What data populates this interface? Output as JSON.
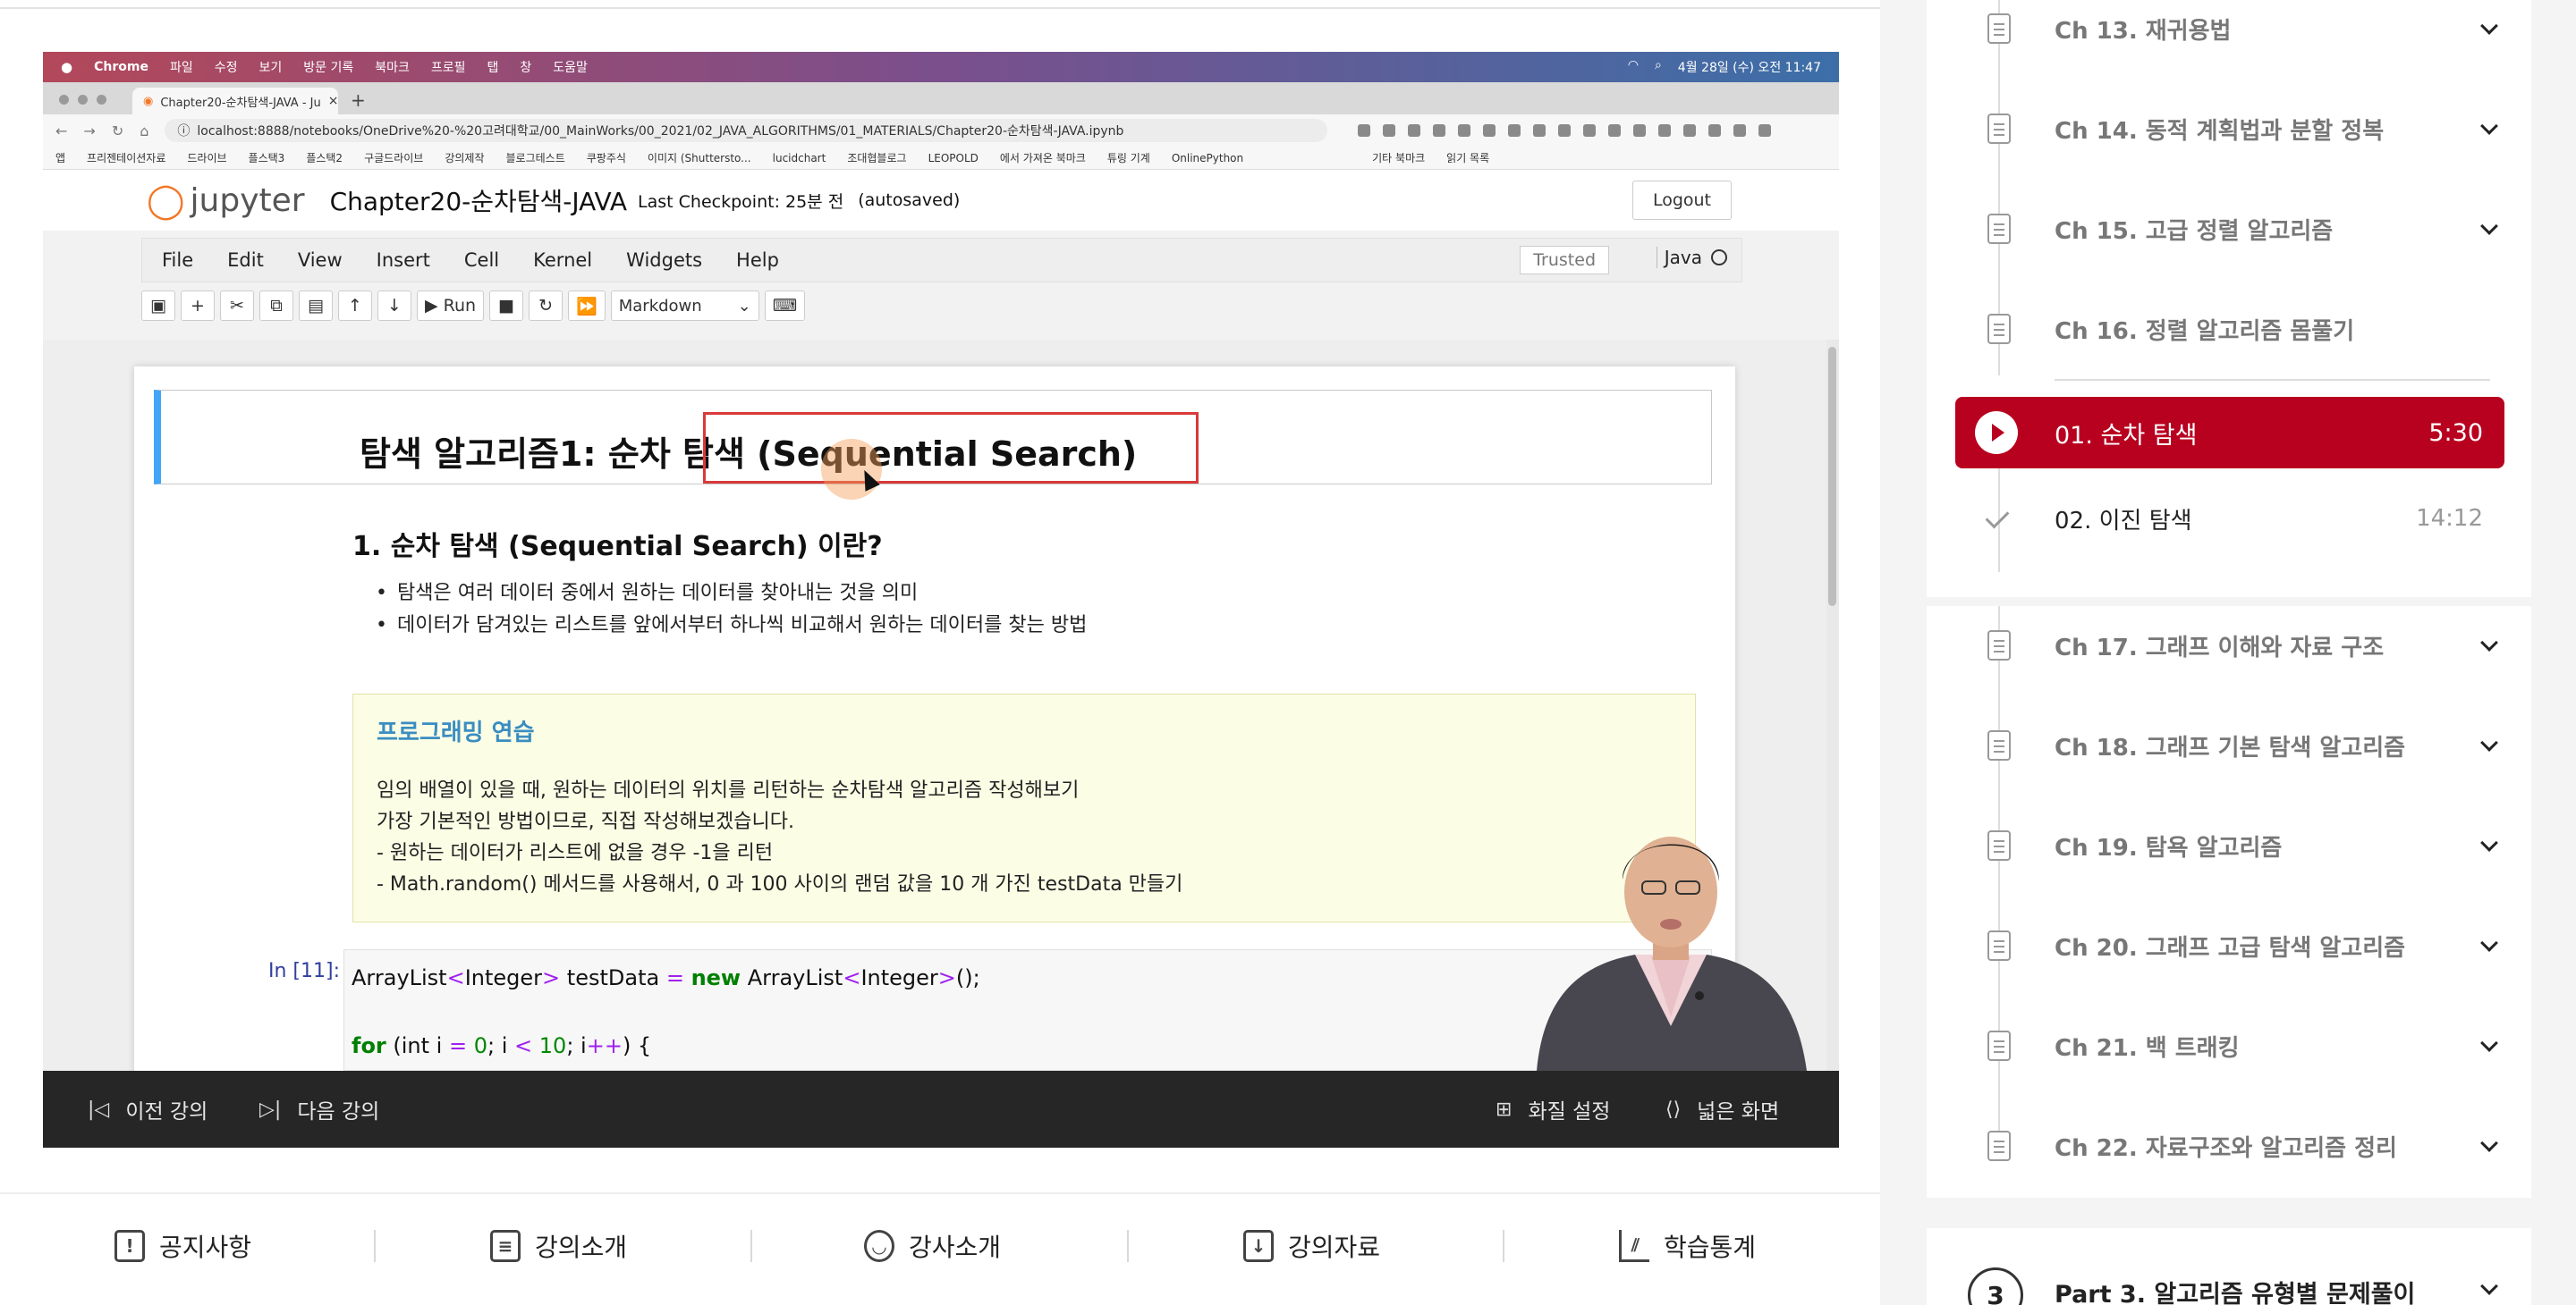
{
  "mac_menubar": {
    "items": [
      "Chrome",
      "파일",
      "수정",
      "보기",
      "방문 기록",
      "북마크",
      "프로필",
      "탭",
      "창",
      "도움말"
    ],
    "clock": "4월 28일 (수) 오전 11:47"
  },
  "browser": {
    "tab_title": "Chapter20-순차탐색-JAVA - Ju",
    "url": "localhost:8888/notebooks/OneDrive%20-%20고려대학교/00_MainWorks/00_2021/02_JAVA_ALGORITHMS/01_MATERIALS/Chapter20-순차탐색-JAVA.ipynb",
    "bookmarks": [
      "앱",
      "프리젠테이션자료",
      "드라이브",
      "플스택3",
      "플스택2",
      "구글드라이브",
      "강의제작",
      "블로그테스트",
      "쿠팡주식",
      "이미지 (Shuttersto...",
      "lucidchart",
      "조대협블로그",
      "LEOPOLD",
      "에서 가져온 북마크",
      "튜링 기계",
      "OnlinePython",
      "기타 북마크",
      "읽기 목록"
    ]
  },
  "jupyter": {
    "logo": "jupyter",
    "notebook_title": "Chapter20-순차탐색-JAVA",
    "checkpoint": "Last Checkpoint: 25분 전",
    "autosaved": "(autosaved)",
    "logout": "Logout",
    "menu": [
      "File",
      "Edit",
      "View",
      "Insert",
      "Cell",
      "Kernel",
      "Widgets",
      "Help"
    ],
    "trusted": "Trusted",
    "kernel": "Java",
    "toolbar": {
      "run": "Run",
      "cell_type": "Markdown"
    }
  },
  "notebook": {
    "h1_prefix": "탐색 알고리즘1: ",
    "h1_highlight": "순차 탐색 (Sequential Search)",
    "h2": "1. 순차 탐색 (Sequential Search) 이란?",
    "bullets": [
      "탐색은 여러 데이터 중에서 원하는 데이터를 찾아내는 것을 의미",
      "데이터가 담겨있는 리스트를 앞에서부터 하나씩 비교해서 원하는 데이터를 찾는 방법"
    ],
    "practice": {
      "title": "프로그래밍 연습",
      "lines": [
        "임의 배열이 있을 때, 원하는 데이터의 위치를 리턴하는 순차탐색 알고리즘 작성해보기",
        "가장 기본적인 방법이므로, 직접 작성해보겠습니다.",
        "- 원하는 데이터가 리스트에 없을 경우 -1을 리턴",
        "- Math.random() 메서드를 사용해서, 0 과 100 사이의 랜덤 값을 10 개 가진 testData 만들기"
      ]
    },
    "in_prompt": "In [11]:",
    "code": {
      "line1_a": "ArrayList",
      "line1_b": "<",
      "line1_c": "Integer",
      "line1_d": ">",
      "line1_e": " testData ",
      "line1_f": "=",
      "line1_g": " ",
      "line1_h": "new",
      "line1_i": " ArrayList",
      "line1_j": "<",
      "line1_k": "Integer",
      "line1_l": ">",
      "line1_m": "();",
      "line2_a": "for",
      "line2_b": " (int i ",
      "line2_c": "=",
      "line2_d": " ",
      "line2_e": "0",
      "line2_f": "; i ",
      "line2_g": "<",
      "line2_h": " ",
      "line2_i": "10",
      "line2_j": "; i",
      "line2_k": "++",
      "line2_l": ") {"
    }
  },
  "player_controls": {
    "prev": "이전 강의",
    "next": "다음 강의",
    "quality": "화질 설정",
    "wide": "넓은 화면"
  },
  "bottom_tabs": [
    "공지사항",
    "강의소개",
    "강사소개",
    "강의자료",
    "학습통계"
  ],
  "sidebar": {
    "chapters_top": [
      "Ch 13. 재귀용법",
      "Ch 14. 동적 계획법과 분할 정복",
      "Ch 15. 고급 정렬 알고리즘",
      "Ch 16. 정렬 알고리즘 몸풀기"
    ],
    "lessons": [
      {
        "label": "01. 순차 탐색",
        "duration": "5:30",
        "active": true
      },
      {
        "label": "02. 이진 탐색",
        "duration": "14:12",
        "active": false
      }
    ],
    "chapters_bottom": [
      "Ch 17. 그래프 이해와 자료 구조",
      "Ch 18. 그래프 기본 탐색 알고리즘",
      "Ch 19. 탐욕 알고리즘",
      "Ch 20. 그래프 고급 탐색 알고리즘",
      "Ch 21. 백 트래킹",
      "Ch 22. 자료구조와 알고리즘 정리"
    ],
    "part": {
      "number": "3",
      "label": "Part 3. 알고리즘 유형별 문제풀이"
    }
  },
  "colors": {
    "accent": "#b8001f",
    "jupyter_orange": "#f37726",
    "cell_border": "#42a5f5"
  }
}
